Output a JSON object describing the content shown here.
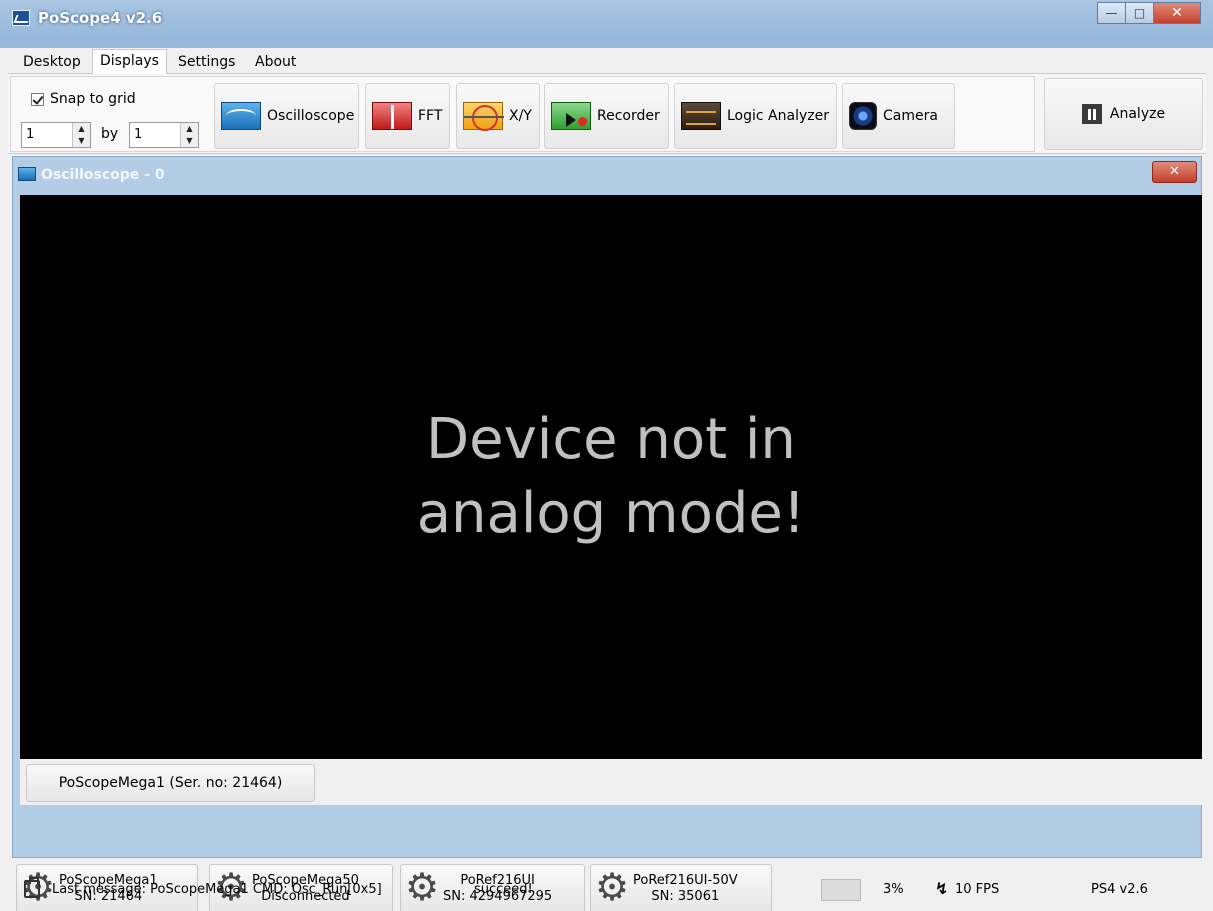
{
  "window": {
    "title": "PoScope4 v2.6",
    "minimize": "—",
    "maximize": "□",
    "close": "✕"
  },
  "menu": {
    "tabs": [
      {
        "label": "Desktop"
      },
      {
        "label": "Displays"
      },
      {
        "label": "Settings"
      },
      {
        "label": "About"
      }
    ]
  },
  "ribbon": {
    "snap_label": "Snap to grid",
    "snap_checked": true,
    "grid_x": "1",
    "grid_by_label": "by",
    "grid_y": "1",
    "buttons": [
      {
        "label": "Oscilloscope",
        "icon": "oscilloscope-icon"
      },
      {
        "label": "FFT",
        "icon": "fft-icon"
      },
      {
        "label": "X/Y",
        "icon": "xy-icon"
      },
      {
        "label": "Recorder",
        "icon": "recorder-icon"
      },
      {
        "label": "Logic Analyzer",
        "icon": "logic-analyzer-icon"
      },
      {
        "label": "Camera",
        "icon": "camera-icon"
      }
    ],
    "analyze_label": "Analyze"
  },
  "subwindow": {
    "title": "Oscilloscope - 0",
    "close": "✕",
    "message": "Device not in analog mode!",
    "device_tab": "PoScopeMega1 (Ser. no: 21464)"
  },
  "devices": [
    {
      "name": "PoScopeMega1",
      "status": "SN: 21464"
    },
    {
      "name": "PoScopeMega50",
      "status": "Disconnected"
    },
    {
      "name": "PoRef216UI",
      "status": "SN: 4294967295"
    },
    {
      "name": "PoRef216UI-50V",
      "status": "SN: 35061"
    }
  ],
  "status": {
    "last_message": "Last message: PoScopeMega1 CMD: Osc_Run[0x5]",
    "result": "succeed!",
    "cpu": "3%",
    "fps": "10 FPS",
    "version": "PS4 v2.6"
  },
  "colors": {
    "title_bar": "#a9c5e2",
    "scope_bg": "#000000",
    "scope_text": "#c0c0c0",
    "close_red": "#c4402c"
  }
}
